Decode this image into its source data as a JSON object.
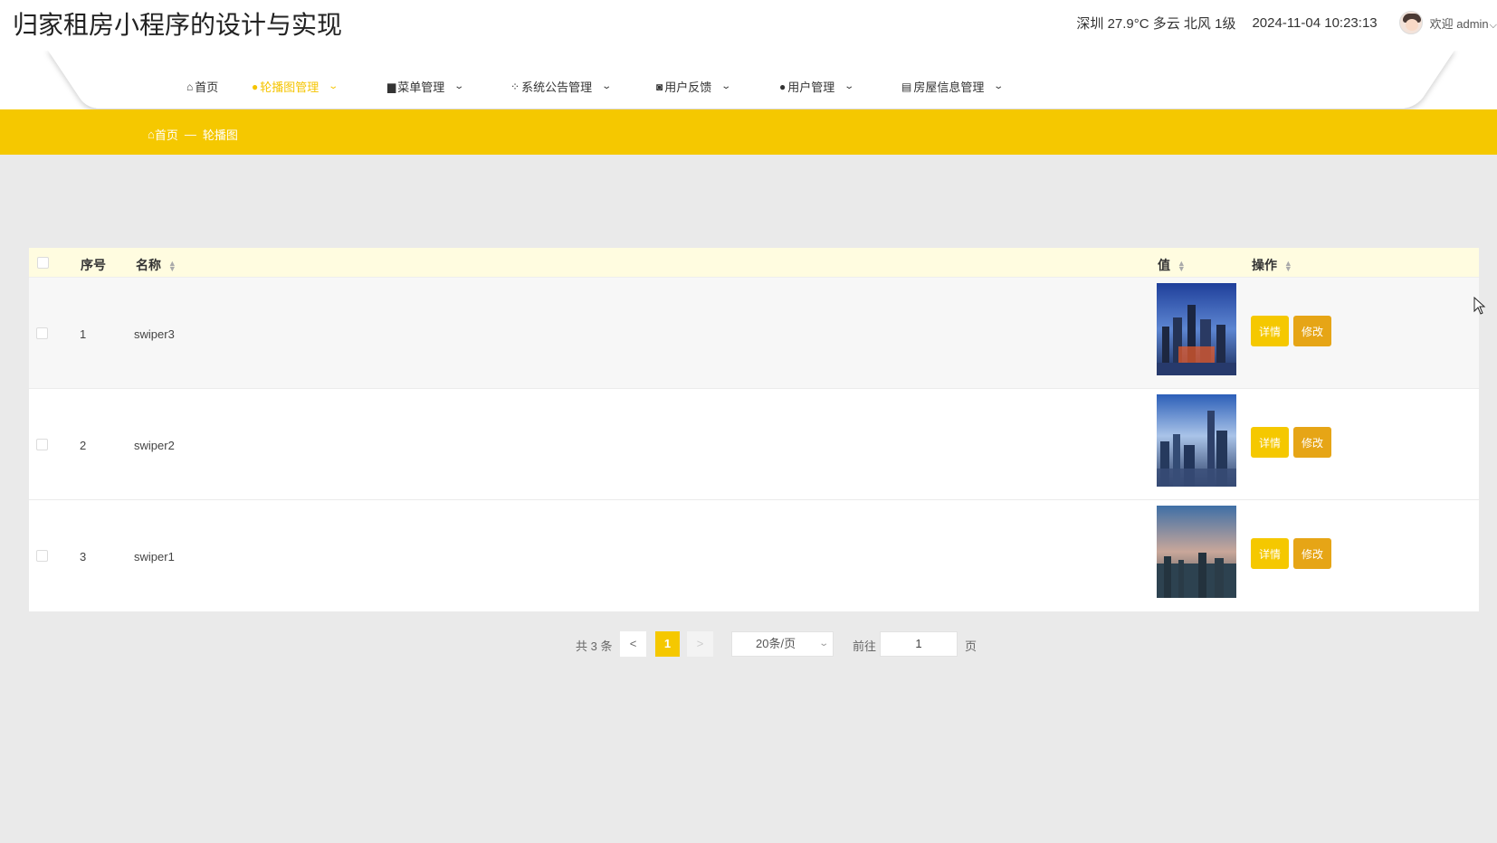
{
  "header": {
    "title": "归家租房小程序的设计与实现",
    "weather": "深圳 27.9°C 多云 北风 1级",
    "datetime": "2024-11-04 10:23:13",
    "welcome": "欢迎 admin",
    "welcome_caret": "⌵"
  },
  "nav": {
    "items": [
      {
        "label": "首页",
        "icon": "home-icon"
      },
      {
        "label": "轮播图管理",
        "icon": "circle-icon",
        "active": true
      },
      {
        "label": "菜单管理",
        "icon": "menu-icon"
      },
      {
        "label": "系统公告管理",
        "icon": "grid-icon"
      },
      {
        "label": "用户反馈",
        "icon": "feedback-icon"
      },
      {
        "label": "用户管理",
        "icon": "user-icon"
      },
      {
        "label": "房屋信息管理",
        "icon": "house-icon"
      }
    ]
  },
  "breadcrumb": {
    "home": "首页",
    "separator": "—",
    "current": "轮播图"
  },
  "table": {
    "columns": {
      "index": "序号",
      "name": "名称",
      "value": "值",
      "action": "操作"
    },
    "rows": [
      {
        "index": "1",
        "name": "swiper3"
      },
      {
        "index": "2",
        "name": "swiper2"
      },
      {
        "index": "3",
        "name": "swiper1"
      }
    ],
    "detail_label": "详情",
    "edit_label": "修改"
  },
  "pagination": {
    "total": "共 3 条",
    "prev": "<",
    "current": "1",
    "next": ">",
    "page_size": "20条/页",
    "goto": "前往",
    "goto_value": "1",
    "page_unit": "页"
  },
  "colors": {
    "accent": "#f5c800",
    "edit": "#e6a516",
    "header_row": "#fffce0"
  }
}
